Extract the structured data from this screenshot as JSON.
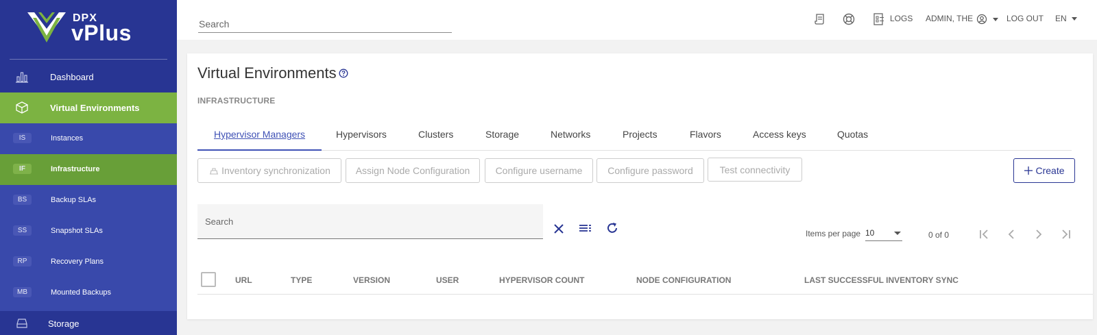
{
  "brand": {
    "top": "DPX",
    "name": "vPlus"
  },
  "sidebar": {
    "main": [
      {
        "label": "Dashboard",
        "icon": "bar-chart-icon"
      },
      {
        "label": "Virtual Environments",
        "icon": "cube-icon"
      }
    ],
    "sub": [
      {
        "badge": "IS",
        "label": "Instances"
      },
      {
        "badge": "IF",
        "label": "Infrastructure"
      },
      {
        "badge": "BS",
        "label": "Backup SLAs"
      },
      {
        "badge": "SS",
        "label": "Snapshot SLAs"
      },
      {
        "badge": "RP",
        "label": "Recovery Plans"
      },
      {
        "badge": "MB",
        "label": "Mounted Backups"
      }
    ],
    "storage": "Storage"
  },
  "topbar": {
    "search_placeholder": "Search",
    "logs": "LOGS",
    "user": "ADMIN, THE",
    "logout": "LOG OUT",
    "lang": "EN"
  },
  "page": {
    "title": "Virtual Environments",
    "section": "INFRASTRUCTURE",
    "tabs": [
      "Hypervisor Managers",
      "Hypervisors",
      "Clusters",
      "Storage",
      "Networks",
      "Projects",
      "Flavors",
      "Access keys",
      "Quotas"
    ],
    "actions": {
      "sync": "Inventory synchronization",
      "assign": "Assign Node Configuration",
      "username": "Configure username",
      "password": "Configure password",
      "test": "Test connectivity",
      "create": "Create"
    },
    "table_search": "Search",
    "items_per_page_label": "Items per page",
    "items_per_page": "10",
    "range": "0 of 0",
    "columns": [
      "URL",
      "TYPE",
      "VERSION",
      "USER",
      "HYPERVISOR COUNT",
      "NODE CONFIGURATION",
      "LAST SUCCESSFUL INVENTORY SYNC"
    ]
  },
  "colors": {
    "sidebar": "#283593",
    "subnav": "#3949ab",
    "active_green": "#7cb342",
    "accent": "#3f51b5"
  }
}
